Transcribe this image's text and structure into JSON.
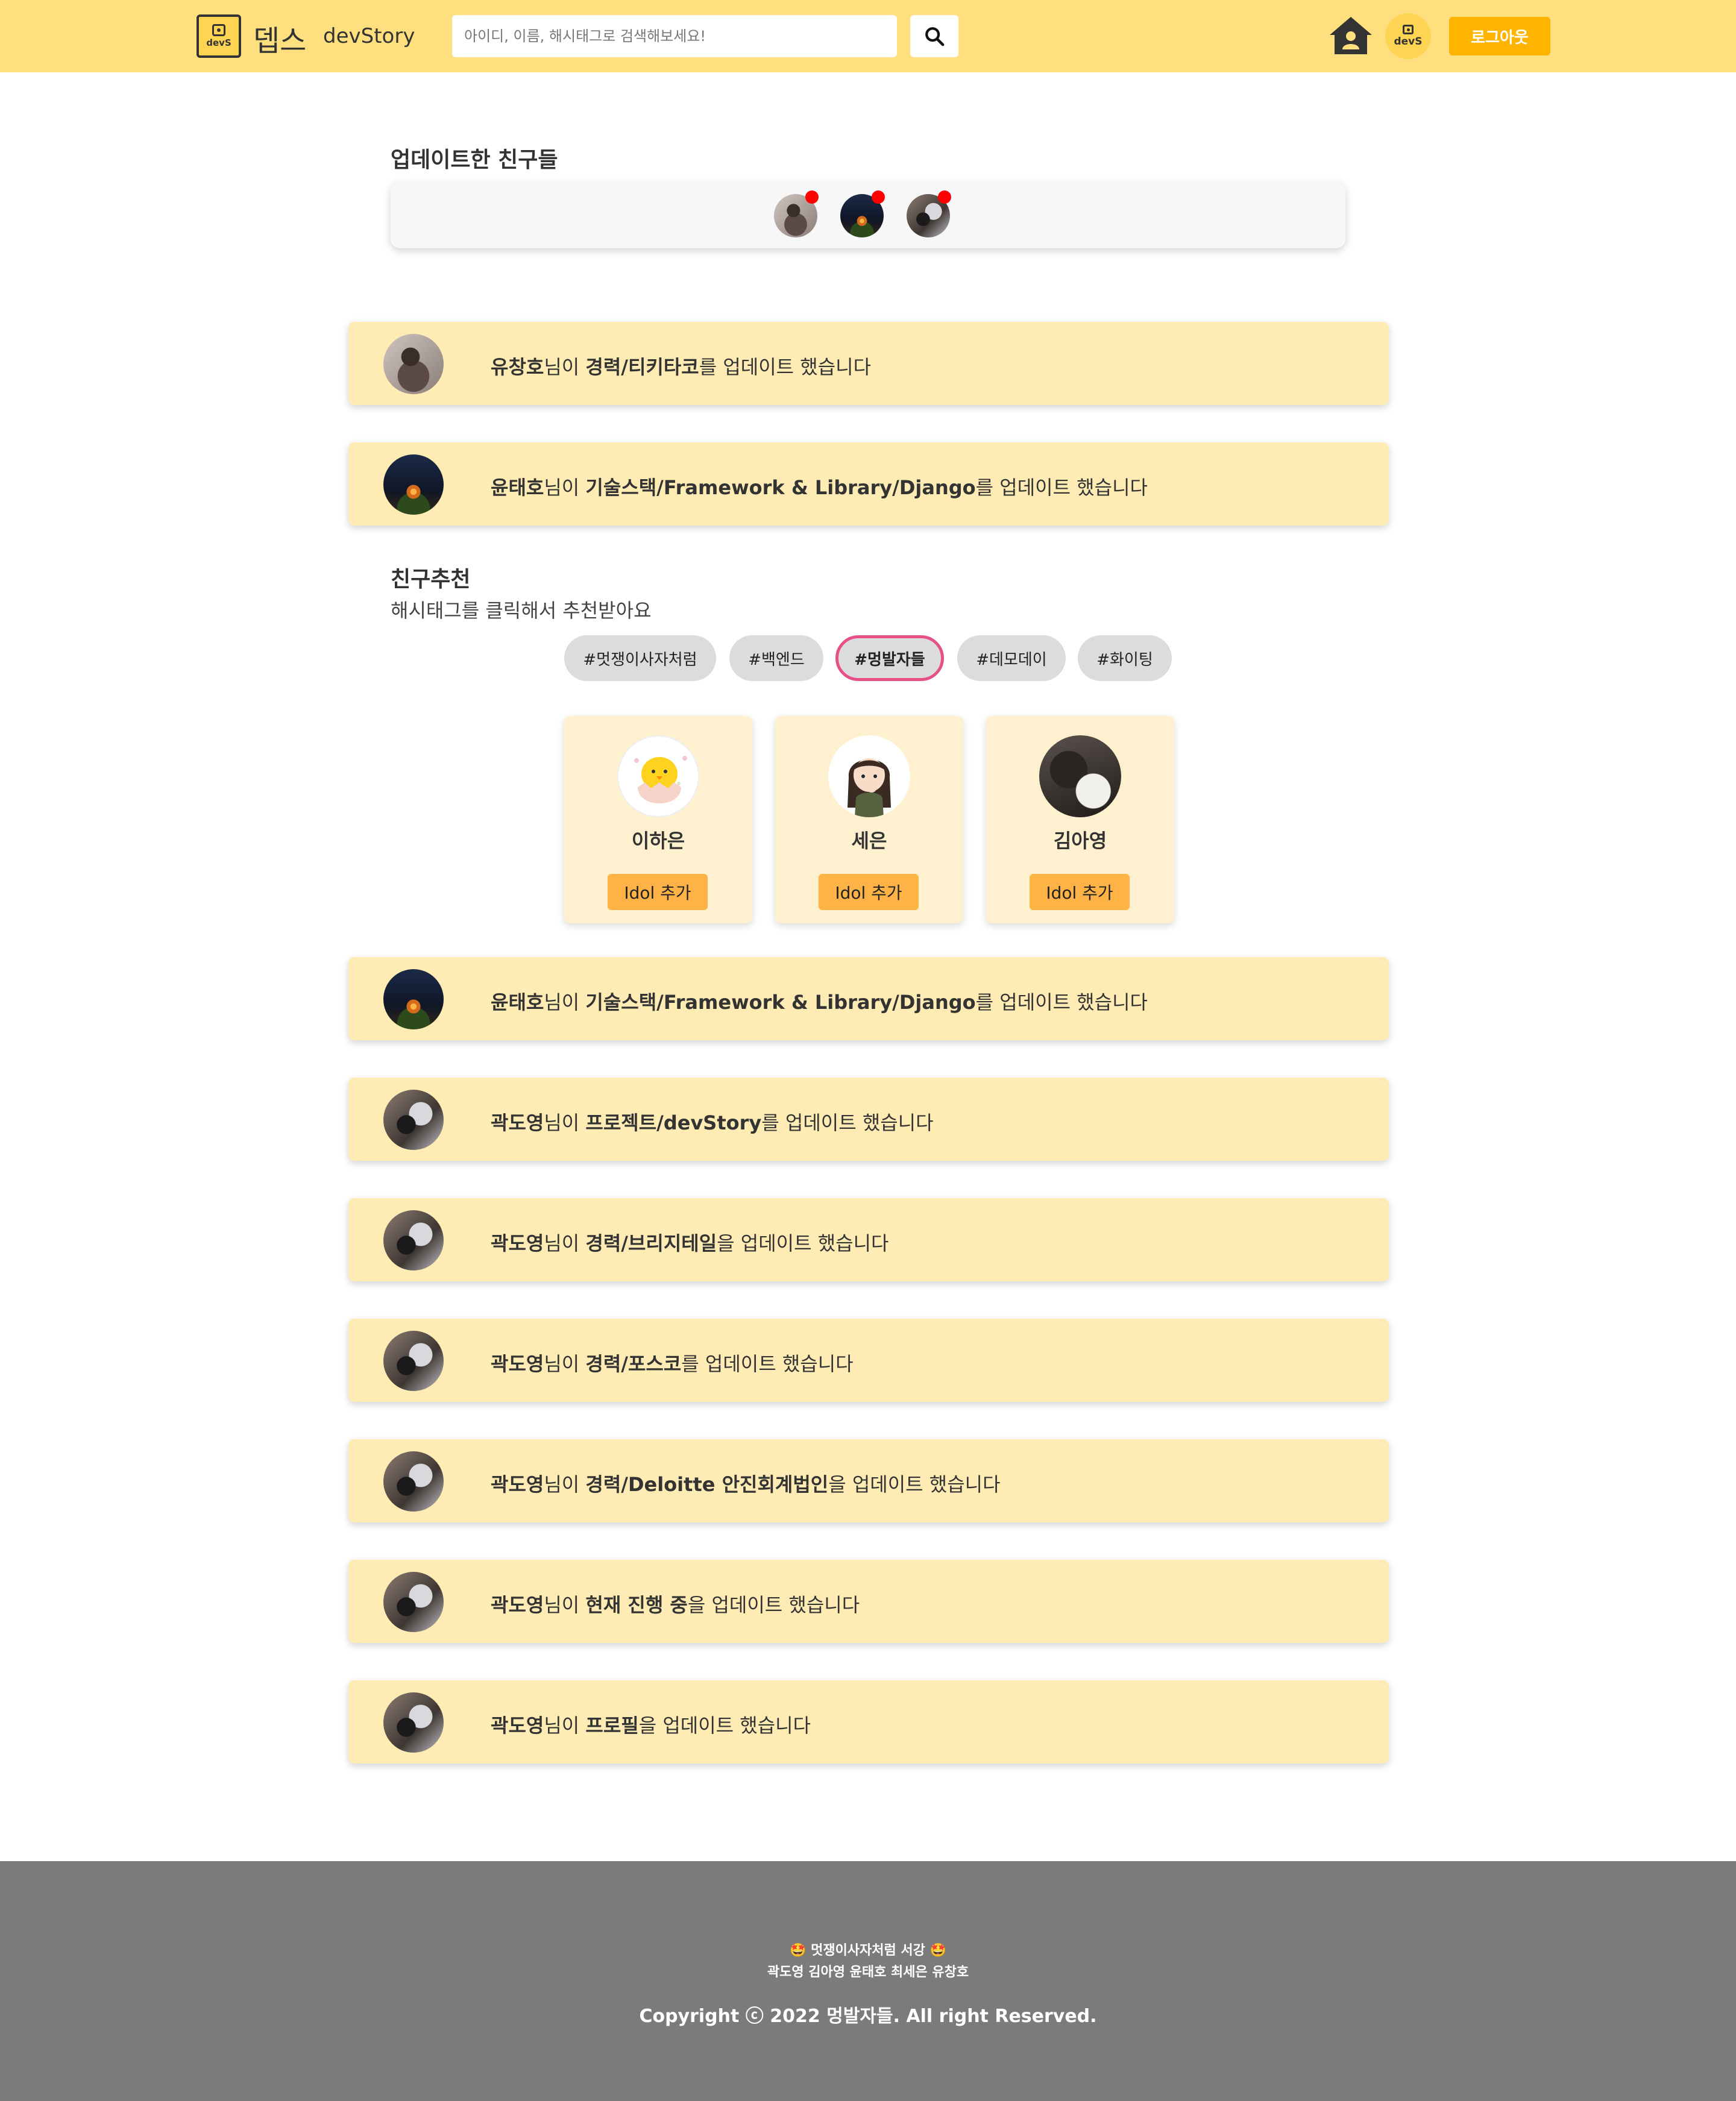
{
  "header": {
    "logo_text": "devS",
    "brand_ko": "뎁스",
    "brand_en": "devStory",
    "search_placeholder": "아이디, 이름, 해시태그로 검색해보세요!",
    "profile_logo_text": "devS",
    "logout_label": "로그아웃",
    "accent_color": "#ffdf7e",
    "button_color": "#ffb400"
  },
  "updated_friends": {
    "title": "업데이트한 친구들"
  },
  "activities_top": [
    {
      "name": "유창호",
      "mid": "님이 ",
      "target": "경력/티키타코",
      "suffix": "를 업데이트 했습니다"
    },
    {
      "name": "윤태호",
      "mid": "님이 ",
      "target": "기술스택/Framework & Library/Django",
      "suffix": "를 업데이트 했습니다"
    }
  ],
  "recommendation": {
    "title": "친구추천",
    "subtitle": "해시태그를 클릭해서 추천받아요",
    "hashtags": [
      "#멋쟁이사자처럼",
      "#백엔드",
      "#멍발자들",
      "#데모데이",
      "#화이팅"
    ],
    "active_hashtag": "#멍발자들",
    "cards": [
      {
        "name": "이하은",
        "button": "Idol 추가"
      },
      {
        "name": "세은",
        "button": "Idol 추가"
      },
      {
        "name": "김아영",
        "button": "Idol 추가"
      }
    ]
  },
  "activities_bottom": [
    {
      "name": "윤태호",
      "mid": "님이 ",
      "target": "기술스택/Framework & Library/Django",
      "suffix": "를 업데이트 했습니다"
    },
    {
      "name": "곽도영",
      "mid": "님이 ",
      "target": "프로젝트/devStory",
      "suffix": "를 업데이트 했습니다"
    },
    {
      "name": "곽도영",
      "mid": "님이 ",
      "target": "경력/브리지테일",
      "suffix": "을 업데이트 했습니다"
    },
    {
      "name": "곽도영",
      "mid": "님이 ",
      "target": "경력/포스코",
      "suffix": "를 업데이트 했습니다"
    },
    {
      "name": "곽도영",
      "mid": "님이 ",
      "target": "경력/Deloitte 안진회계법인",
      "suffix": "을 업데이트 했습니다"
    },
    {
      "name": "곽도영",
      "mid": "님이 ",
      "target": "현재 진행 중",
      "suffix": "을 업데이트 했습니다"
    },
    {
      "name": "곽도영",
      "mid": "님이 ",
      "target": "프로필",
      "suffix": "을 업데이트 했습니다"
    }
  ],
  "footer": {
    "line1": "🤩 멋쟁이사자처럼 서강 🤩",
    "line2": "곽도영 김아영 윤태호 최세은 유창호",
    "copyright": "Copyright ⓒ 2022 멍발자들. All right Reserved."
  }
}
